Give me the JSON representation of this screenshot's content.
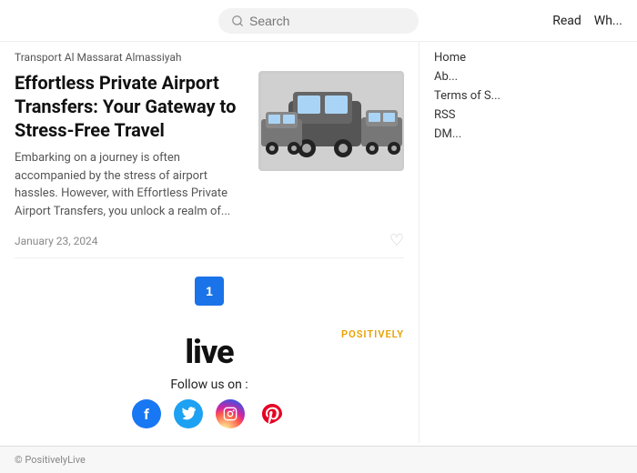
{
  "header": {
    "search_placeholder": "Search",
    "nav_items": [
      {
        "label": "Read",
        "href": "#"
      },
      {
        "label": "Wh...",
        "href": "#"
      }
    ]
  },
  "breadcrumb": {
    "text": "Transport Al Massarat Almassiyah"
  },
  "article": {
    "title": "Effortless Private Airport Transfers: Your Gateway to Stress-Free Travel",
    "excerpt": "Embarking on a journey is often accompanied by the stress of airport hassles. However, with Effortless Private Airport Transfers, you unlock a realm of...",
    "date": "January 23, 2024"
  },
  "pagination": {
    "current_page": "1"
  },
  "brand": {
    "positively_label": "POSITIVELY",
    "logo_text": "live",
    "follow_text": "Follow us on :"
  },
  "social": {
    "facebook_symbol": "f",
    "twitter_symbol": "🐦",
    "instagram_symbol": "📷",
    "pinterest_symbol": "P"
  },
  "sidebar": {
    "links": [
      {
        "label": "Home",
        "href": "#"
      },
      {
        "label": "Ab...",
        "href": "#"
      },
      {
        "label": "Terms of S...",
        "href": "#"
      },
      {
        "label": "RSS",
        "href": "#"
      },
      {
        "label": "DM...",
        "href": "#"
      }
    ]
  },
  "footer": {
    "text": "© PositivelyLive"
  }
}
